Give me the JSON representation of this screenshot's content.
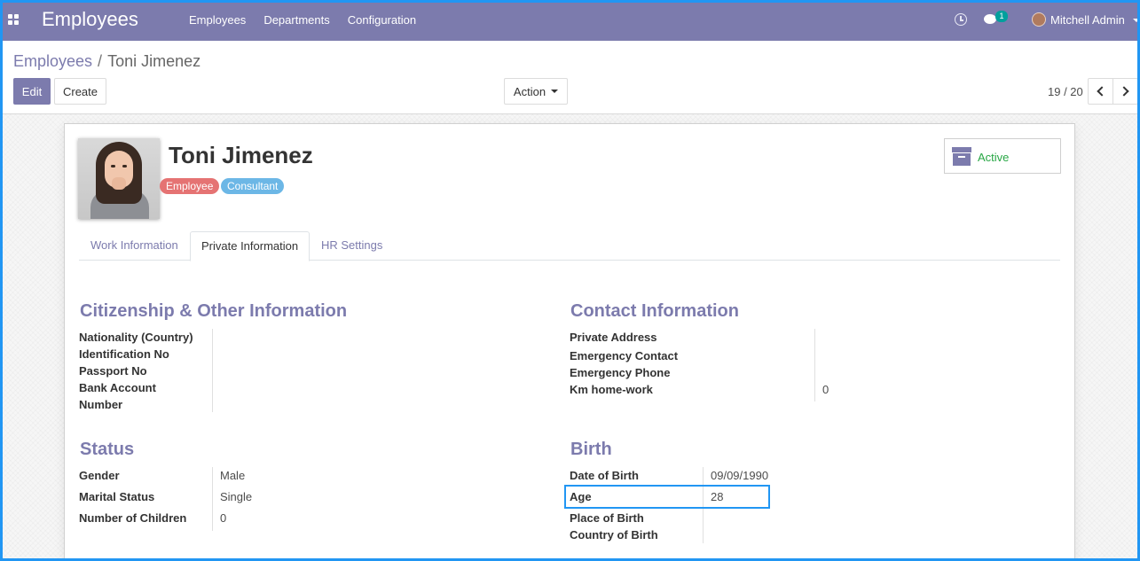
{
  "navbar": {
    "brand": "Employees",
    "menu": [
      "Employees",
      "Departments",
      "Configuration"
    ],
    "chat_count": "1",
    "user_name": "Mitchell Admin"
  },
  "control_panel": {
    "breadcrumb_parent": "Employees",
    "breadcrumb_separator": "/",
    "breadcrumb_current": "Toni Jimenez",
    "edit_label": "Edit",
    "create_label": "Create",
    "action_label": "Action",
    "pager": "19 / 20"
  },
  "employee": {
    "name": "Toni Jimenez",
    "tags": [
      "Employee",
      "Consultant"
    ],
    "status_button": "Active"
  },
  "tabs": [
    "Work Information",
    "Private Information",
    "HR Settings"
  ],
  "active_tab": "Private Information",
  "citizenship": {
    "title": "Citizenship & Other Information",
    "fields": {
      "nationality": "Nationality (Country)",
      "identification": "Identification No",
      "passport": "Passport No",
      "bank_account_line1": "Bank Account",
      "bank_account_line2": "Number"
    }
  },
  "contact": {
    "title": "Contact Information",
    "fields": {
      "private_address": "Private Address",
      "emergency_contact": "Emergency Contact",
      "emergency_phone": "Emergency Phone",
      "km_home_work": "Km home-work"
    },
    "values": {
      "km_home_work": "0"
    }
  },
  "status": {
    "title": "Status",
    "fields": {
      "gender": "Gender",
      "marital": "Marital Status",
      "children": "Number of Children"
    },
    "values": {
      "gender": "Male",
      "marital": "Single",
      "children": "0"
    }
  },
  "birth": {
    "title": "Birth",
    "fields": {
      "dob": "Date of Birth",
      "age": "Age",
      "place": "Place of Birth",
      "country": "Country of Birth"
    },
    "values": {
      "dob": "09/09/1990",
      "age": "28"
    }
  },
  "colors": {
    "primary": "#7c7bad",
    "highlight": "#2196f3",
    "tag_employee": "#e57373",
    "tag_consultant": "#6cb7e6",
    "active": "#28a745"
  }
}
